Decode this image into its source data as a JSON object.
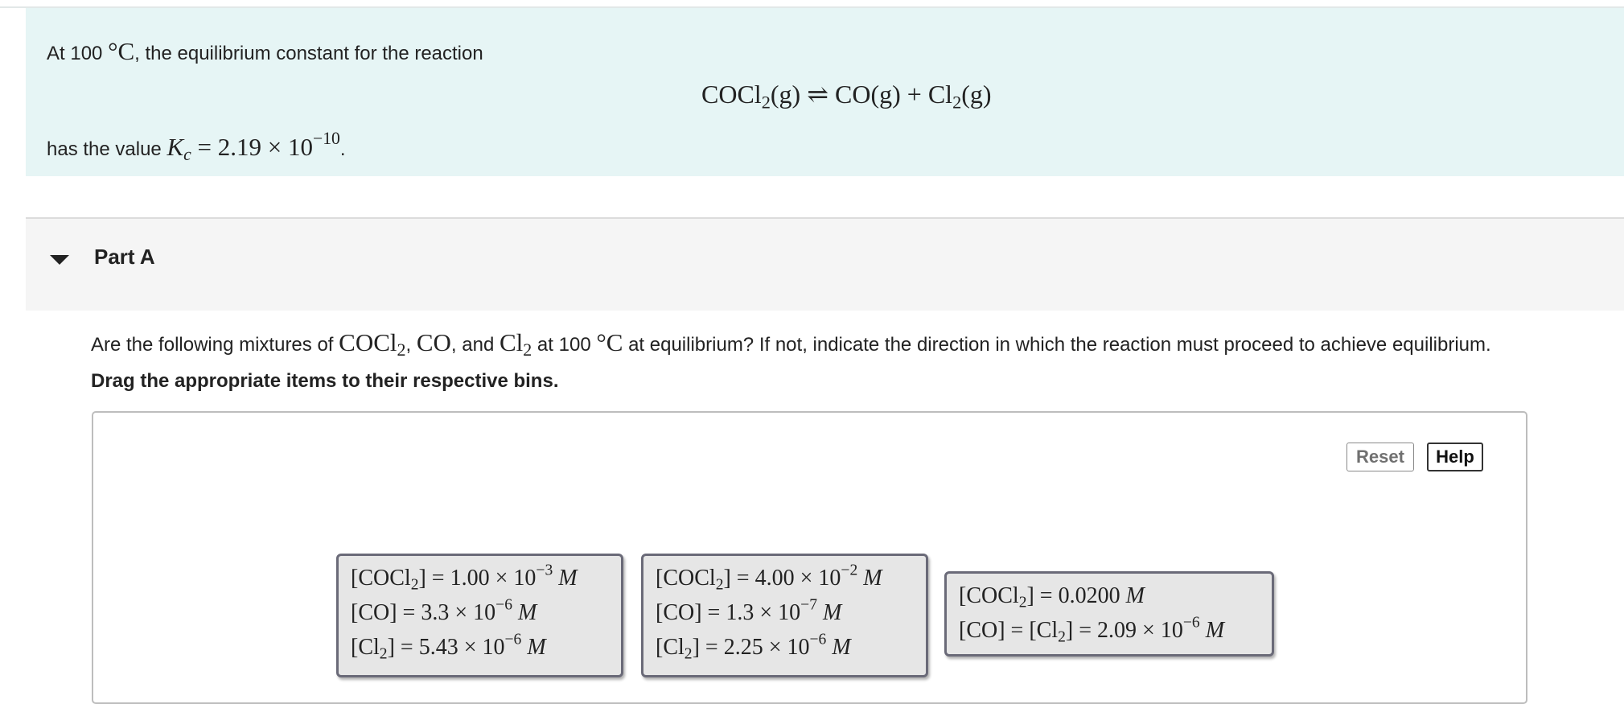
{
  "intro": {
    "line1_prefix": "At 100 ",
    "line1_unit": "°C",
    "line1_suffix": ", the equilibrium constant for the reaction",
    "equation": {
      "reactant": "COCl",
      "reactant_sub": "2",
      "reactant_state": "(g)",
      "arrow": "⇌",
      "product1": "CO(g)",
      "plus": "+",
      "product2": "Cl",
      "product2_sub": "2",
      "product2_state": "(g)"
    },
    "line3_prefix": "has the value ",
    "kc_symbol": "K",
    "kc_sub": "c",
    "kc_equals": " = 2.19 × 10",
    "kc_exp": "−10",
    "line3_suffix": "."
  },
  "part": {
    "title": "Part A",
    "question": {
      "prefix": "Are the following mixtures of ",
      "s1": "COCl",
      "s1_sub": "2",
      "sep1": ", ",
      "s2": "CO",
      "sep2": ", and ",
      "s3": "Cl",
      "s3_sub": "2",
      "mid": " at 100 ",
      "unit": "°C",
      "suffix": " at equilibrium? If not, indicate the direction in which the reaction must proceed to achieve equilibrium."
    },
    "instruction": "Drag the appropriate items to their respective bins."
  },
  "toolbar": {
    "reset_label": "Reset",
    "help_label": "Help"
  },
  "items": [
    {
      "rows": [
        {
          "a": "[COCl",
          "sub": "2",
          "b": "] = 1.00 × 10",
          "sup": "−3",
          "unit": "M"
        },
        {
          "a": "[CO] = 3.3 × 10",
          "sub": "",
          "b": "",
          "sup": "−6",
          "unit": "M"
        },
        {
          "a": "[Cl",
          "sub": "2",
          "b": "] = 5.43 × 10",
          "sup": "−6",
          "unit": "M"
        }
      ]
    },
    {
      "rows": [
        {
          "a": "[COCl",
          "sub": "2",
          "b": "] = 4.00 × 10",
          "sup": "−2",
          "unit": "M"
        },
        {
          "a": "[CO] = 1.3 × 10",
          "sub": "",
          "b": "",
          "sup": "−7",
          "unit": "M"
        },
        {
          "a": "[Cl",
          "sub": "2",
          "b": "] = 2.25 × 10",
          "sup": "−6",
          "unit": "M"
        }
      ]
    },
    {
      "rows": [
        {
          "a": "[COCl",
          "sub": "2",
          "b": "] = 0.0200 ",
          "sup": "",
          "unit": "M"
        },
        {
          "a": "[CO] = [Cl",
          "sub": "2",
          "b": "] = 2.09 × 10",
          "sup": "−6",
          "unit": "M"
        }
      ]
    }
  ]
}
